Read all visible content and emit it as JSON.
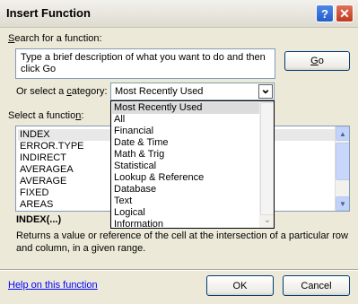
{
  "window": {
    "title": "Insert Function",
    "help_glyph": "?",
    "close_glyph": "✕"
  },
  "search": {
    "label_prefix": "",
    "label_key": "S",
    "label_rest": "earch for a function:",
    "value": "Type a brief description of what you want to do and then click Go",
    "go_key": "G",
    "go_rest": "o"
  },
  "category": {
    "label_before": "Or select a ",
    "label_key": "c",
    "label_rest": "ategory:",
    "selected": "Most Recently Used",
    "arrow_glyph": "⌄",
    "options": [
      "Most Recently Used",
      "All",
      "Financial",
      "Date & Time",
      "Math & Trig",
      "Statistical",
      "Lookup & Reference",
      "Database",
      "Text",
      "Logical",
      "Information"
    ]
  },
  "functions": {
    "label_before": "Select a functio",
    "label_key": "n",
    "label_rest": ":",
    "items": [
      "INDEX",
      "ERROR.TYPE",
      "INDIRECT",
      "AVERAGEA",
      "AVERAGE",
      "FIXED",
      "AREAS"
    ],
    "selected_index": 0,
    "up_glyph": "▲",
    "down_glyph": "▼"
  },
  "description": {
    "signature": "INDEX(...)",
    "text": "Returns a value or reference of the cell at the intersection of a particular row and column, in a given range."
  },
  "footer": {
    "help_link": "Help on this function",
    "ok_label": "OK",
    "cancel_label": "Cancel"
  }
}
